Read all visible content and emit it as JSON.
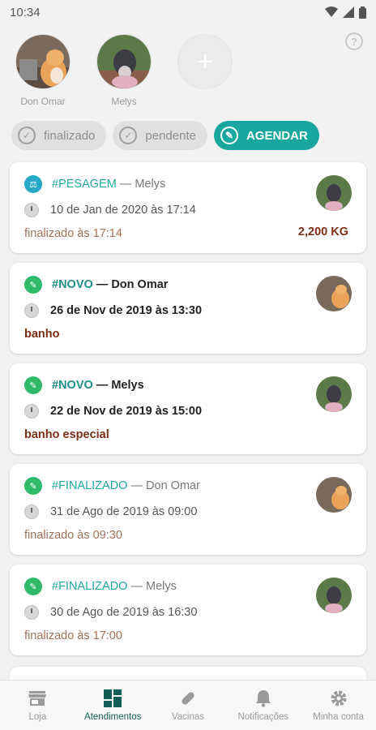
{
  "status_bar": {
    "time": "10:34"
  },
  "pets": [
    {
      "name": "Don Omar",
      "avatar": "cat-avatar"
    },
    {
      "name": "Melys",
      "avatar": "dog-avatar"
    }
  ],
  "add_pet": {
    "icon": "plus-icon",
    "label": "+"
  },
  "filters": {
    "finalized": "finalizado",
    "pending": "pendente",
    "schedule": "AGENDAR"
  },
  "appointments": [
    {
      "tag": "#PESAGEM",
      "separator": "—",
      "pet": "Melys",
      "date": "10 de Jan de 2020 às 17:14",
      "note": "finalizado às 17:14",
      "weight": "2,200 KG",
      "icon": "scale-icon"
    },
    {
      "tag": "#NOVO",
      "separator": "—",
      "pet": "Don Omar",
      "date": "26 de Nov de 2019 às 13:30",
      "note": "banho",
      "icon": "brush-icon"
    },
    {
      "tag": "#NOVO",
      "separator": "—",
      "pet": "Melys",
      "date": "22 de Nov de 2019 às 15:00",
      "note": "banho especial",
      "icon": "brush-icon"
    },
    {
      "tag": "#FINALIZADO",
      "separator": "—",
      "pet": "Don Omar",
      "date": "31 de Ago de 2019 às 09:00",
      "note": "finalizado às 09:30",
      "icon": "brush-icon"
    },
    {
      "tag": "#FINALIZADO",
      "separator": "—",
      "pet": "Melys",
      "date": "30 de Ago de 2019 às 16:30",
      "note": "finalizado às 17:00",
      "icon": "brush-icon"
    }
  ],
  "nav": [
    {
      "label": "Loja",
      "icon": "store-icon"
    },
    {
      "label": "Atendimentos",
      "icon": "dashboard-icon",
      "active": true
    },
    {
      "label": "Vacinas",
      "icon": "pill-icon"
    },
    {
      "label": "Notificações",
      "icon": "bell-icon"
    },
    {
      "label": "Minha conta",
      "icon": "gear-icon"
    }
  ],
  "colors": {
    "primary": "#1aa7a0",
    "nav_active": "#155e58",
    "accent_brown": "#7c2e16"
  }
}
